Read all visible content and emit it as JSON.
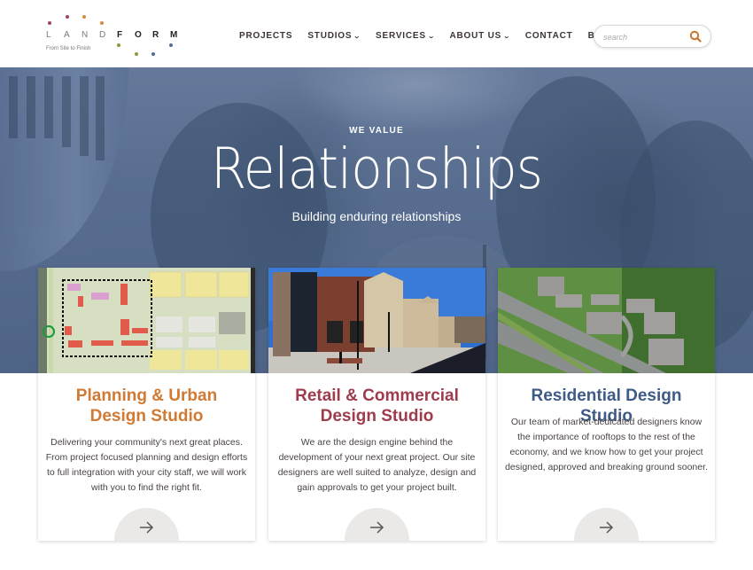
{
  "logo": {
    "land_letters": [
      "L",
      "A",
      "N",
      "D"
    ],
    "form_letters": [
      "F",
      "O",
      "R",
      "M"
    ],
    "tagline": "From Site to Finish",
    "dot_colors": [
      "#a0475a",
      "#a0475a",
      "#d98b3a",
      "#d98b3a",
      "#8a9a3a",
      "#8a9a3a",
      "#4f6c9a",
      "#4f6c9a"
    ]
  },
  "nav": {
    "items": [
      {
        "label": "PROJECTS",
        "has_dropdown": false
      },
      {
        "label": "STUDIOS",
        "has_dropdown": true
      },
      {
        "label": "SERVICES",
        "has_dropdown": true
      },
      {
        "label": "ABOUT US",
        "has_dropdown": true
      },
      {
        "label": "CONTACT",
        "has_dropdown": false
      },
      {
        "label": "BLOG",
        "has_dropdown": false
      }
    ],
    "dropdown_glyph": "⌄"
  },
  "search": {
    "placeholder": "search",
    "value": "",
    "icon": "search-icon",
    "icon_color": "#c8752f"
  },
  "hero": {
    "kicker": "WE VALUE",
    "title": "Relationships",
    "subtitle": "Building enduring relationships"
  },
  "cards": [
    {
      "title_line1": "Planning & Urban",
      "title_line2": "Design Studio",
      "title_color": "#d07a34",
      "text": "Delivering your community's next great places. From project focused planning and design efforts to full integration with your city staff, we will work with you to find the right fit.",
      "image_alt": "Urban planning site plan"
    },
    {
      "title_line1": "Retail & Commercial",
      "title_line2": "Design Studio",
      "title_color": "#9e3b4d",
      "text": "We are the design engine behind the development of your next great project. Our site designers are well suited to analyze, design and gain approvals to get your project built.",
      "image_alt": "Retail commercial storefronts"
    },
    {
      "title_line1": "Residential Design Studio",
      "title_line2": "",
      "title_color": "#3e5a86",
      "text": "Our team of market-dedicated designers know the importance of rooftops to the rest of the economy, and we know how to get your project designed, approved and breaking ground sooner.",
      "image_alt": "Aerial view of residential homes"
    }
  ],
  "colors": {
    "nav_text": "#3d3533",
    "body_text": "#4a4443",
    "hero_overlay": "#586d8f",
    "arrow_button_bg": "#ebe9e7"
  }
}
